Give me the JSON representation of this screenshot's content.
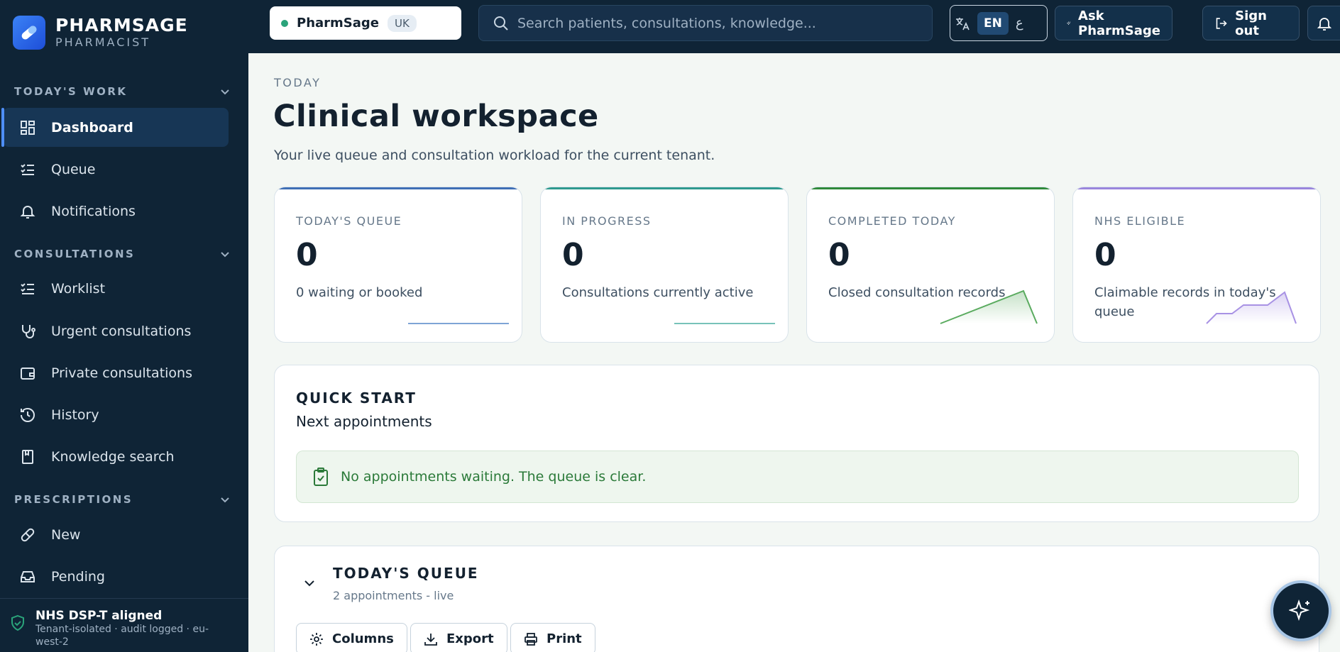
{
  "brand": {
    "name": "PHARMSAGE",
    "role": "PHARMACIST"
  },
  "sidebar": {
    "sections": [
      {
        "label": "TODAY'S WORK",
        "items": [
          {
            "label": "Dashboard",
            "icon": "dashboard-icon",
            "active": true
          },
          {
            "label": "Queue",
            "icon": "list-check-icon"
          },
          {
            "label": "Notifications",
            "icon": "bell-icon"
          }
        ]
      },
      {
        "label": "CONSULTATIONS",
        "items": [
          {
            "label": "Worklist",
            "icon": "list-check-icon"
          },
          {
            "label": "Urgent consultations",
            "icon": "stethoscope-icon"
          },
          {
            "label": "Private consultations",
            "icon": "wallet-icon"
          },
          {
            "label": "History",
            "icon": "history-icon"
          },
          {
            "label": "Knowledge search",
            "icon": "book-icon"
          }
        ]
      },
      {
        "label": "PRESCRIPTIONS",
        "items": [
          {
            "label": "New",
            "icon": "pill-icon"
          },
          {
            "label": "Pending",
            "icon": "inbox-icon"
          }
        ]
      }
    ],
    "footer": {
      "title": "NHS DSP-T aligned",
      "subtitle": "Tenant-isolated · audit logged · eu-west-2"
    }
  },
  "topbar": {
    "tenant": {
      "name": "PharmSage",
      "badge": "UK"
    },
    "search_placeholder": "Search patients, consultations, knowledge...",
    "lang": {
      "primary": "EN",
      "secondary": "ع"
    },
    "ask_label": "Ask PharmSage",
    "signout_label": "Sign out"
  },
  "page": {
    "eyebrow": "TODAY",
    "title": "Clinical workspace",
    "subtitle": "Your live queue and consultation workload for the current tenant."
  },
  "cards": [
    {
      "label": "TODAY'S QUEUE",
      "value": "0",
      "desc": "0 waiting or booked",
      "accent": "#3f6fb5",
      "spark": "#7ea4d6"
    },
    {
      "label": "IN PROGRESS",
      "value": "0",
      "desc": "Consultations currently active",
      "accent": "#2e9a8e",
      "spark": "#77c2b9"
    },
    {
      "label": "COMPLETED TODAY",
      "value": "0",
      "desc": "Closed consultation records",
      "accent": "#2f8a3a",
      "spark": "#5aab5f"
    },
    {
      "label": "NHS ELIGIBLE",
      "value": "0",
      "desc": "Claimable records in today's queue",
      "accent": "#9a86dc",
      "spark": "#a892e4"
    }
  ],
  "quickstart": {
    "title": "QUICK START",
    "subtitle": "Next appointments",
    "notice": "No appointments waiting. The queue is clear."
  },
  "queue": {
    "title": "TODAY'S QUEUE",
    "subtitle": "2 appointments - live",
    "buttons": [
      "Columns",
      "Export",
      "Print"
    ]
  }
}
